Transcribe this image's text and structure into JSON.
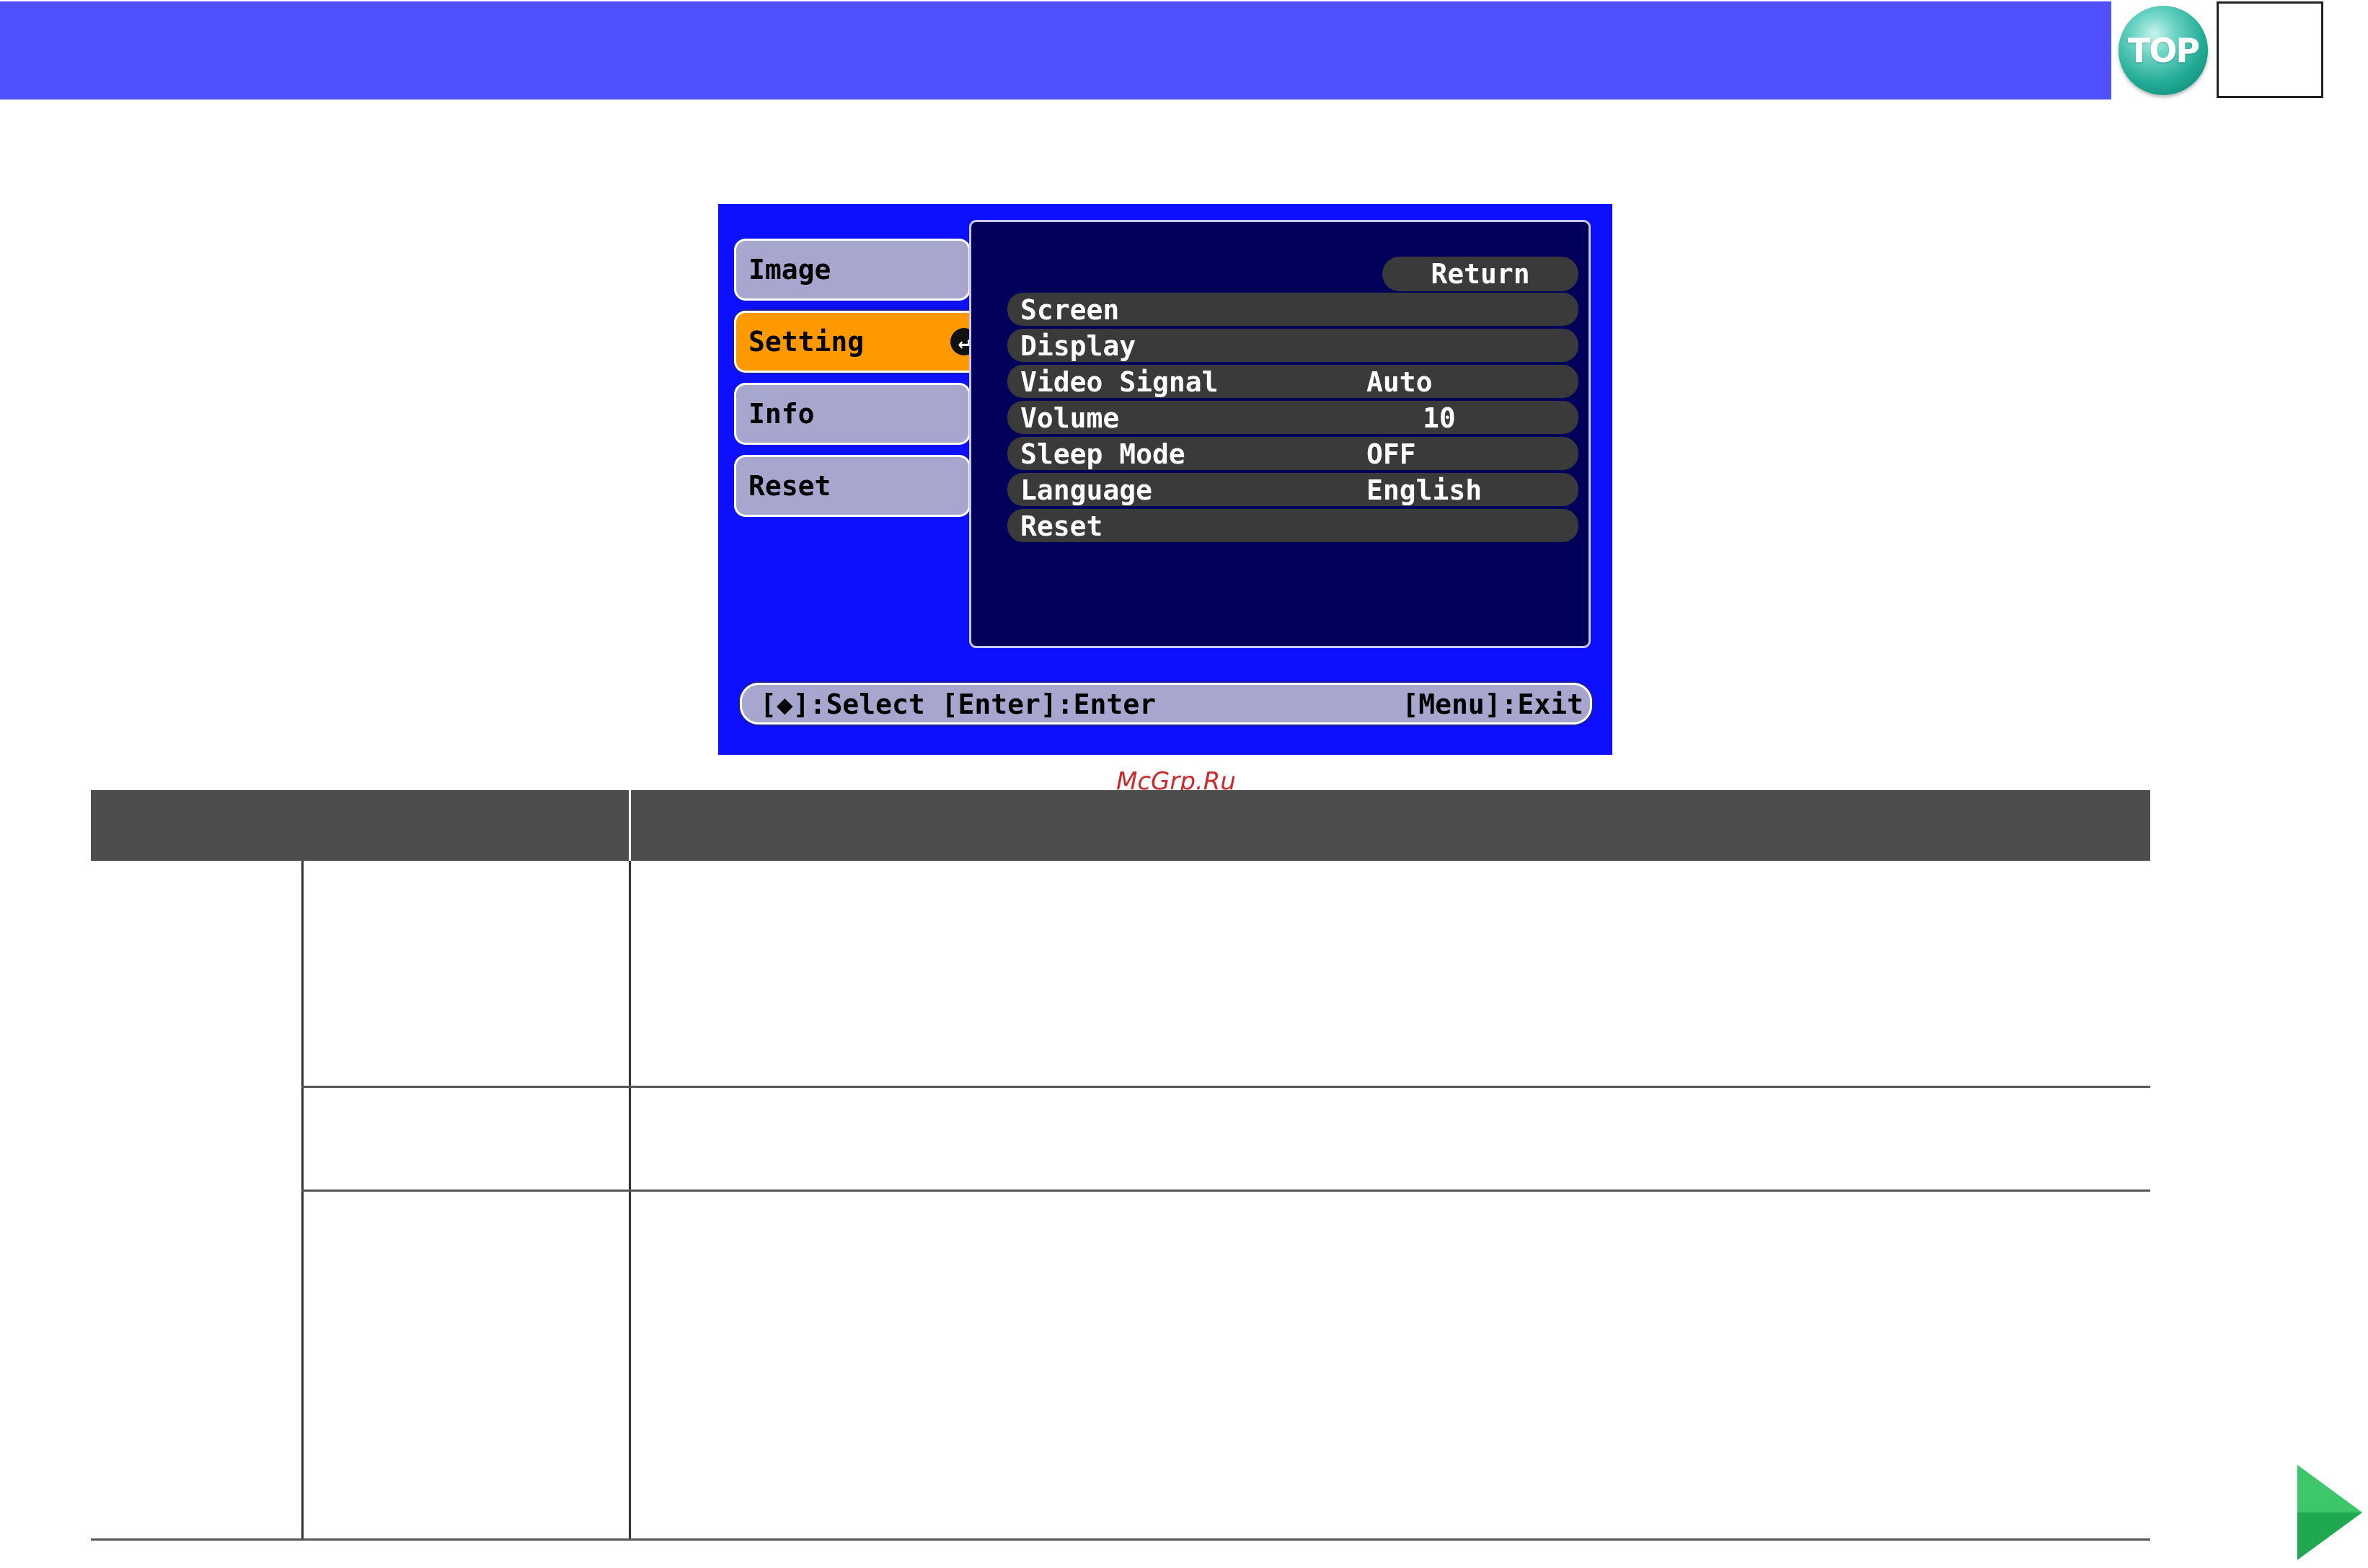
{
  "header": {
    "top_button_label": "TOP",
    "accent_color": "#5050ff"
  },
  "osd": {
    "tabs": [
      {
        "label": "Image",
        "active": false
      },
      {
        "label": "Setting",
        "active": true
      },
      {
        "label": "Info",
        "active": false
      },
      {
        "label": "Reset",
        "active": false
      }
    ],
    "return_label": "Return",
    "items": [
      {
        "label": "Screen",
        "value": ""
      },
      {
        "label": "Display",
        "value": ""
      },
      {
        "label": "Video Signal",
        "value": "Auto"
      },
      {
        "label": "Volume",
        "value": "10"
      },
      {
        "label": "Sleep Mode",
        "value": "OFF"
      },
      {
        "label": "Language",
        "value": "English"
      },
      {
        "label": "Reset",
        "value": ""
      }
    ],
    "status_left": "[◆]:Select [Enter]:Enter",
    "status_right": "[Menu]:Exit",
    "enter_icon": "enter-icon"
  },
  "watermark": "McGrp.Ru",
  "navigation": {
    "next_icon": "next-page-arrow-icon",
    "arrow_color": "#1fa84f"
  }
}
